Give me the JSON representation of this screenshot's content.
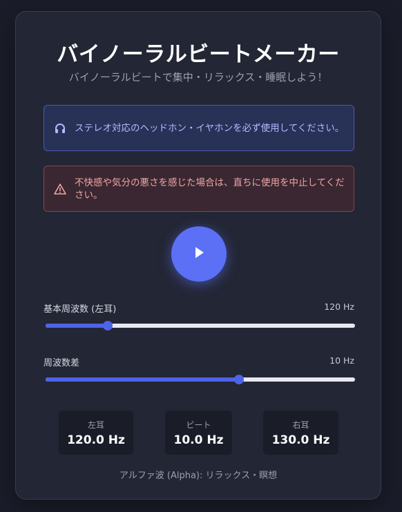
{
  "header": {
    "title": "バイノーラルビートメーカー",
    "subtitle": "バイノーラルビートで集中・リラックス・睡眠しよう！"
  },
  "notices": {
    "info": {
      "icon": "headphones-icon",
      "text": "ステレオ対応のヘッドホン・イヤホンを必ず使用してください。"
    },
    "warning": {
      "icon": "warning-triangle-icon",
      "text": "不快感や気分の悪さを感じた場合は、直ちに使用を中止してください。"
    }
  },
  "player": {
    "icon": "play-icon"
  },
  "sliders": {
    "base": {
      "label": "基本周波数 (左耳)",
      "value_text": "120 Hz",
      "level": 0.2
    },
    "diff": {
      "label": "周波数差",
      "value_text": "10 Hz",
      "level": 0.625
    }
  },
  "stats": {
    "left": {
      "label": "左耳",
      "value": "120.0 Hz"
    },
    "beat": {
      "label": "ビート",
      "value": "10.0 Hz"
    },
    "right": {
      "label": "右耳",
      "value": "130.0 Hz"
    }
  },
  "wave_description": "アルファ波 (Alpha): リラックス・瞑想",
  "colors": {
    "accent": "#5b70f5",
    "info_text": "#aebcff",
    "warning_text": "#f0a6a6",
    "background": "#1a1d29"
  }
}
